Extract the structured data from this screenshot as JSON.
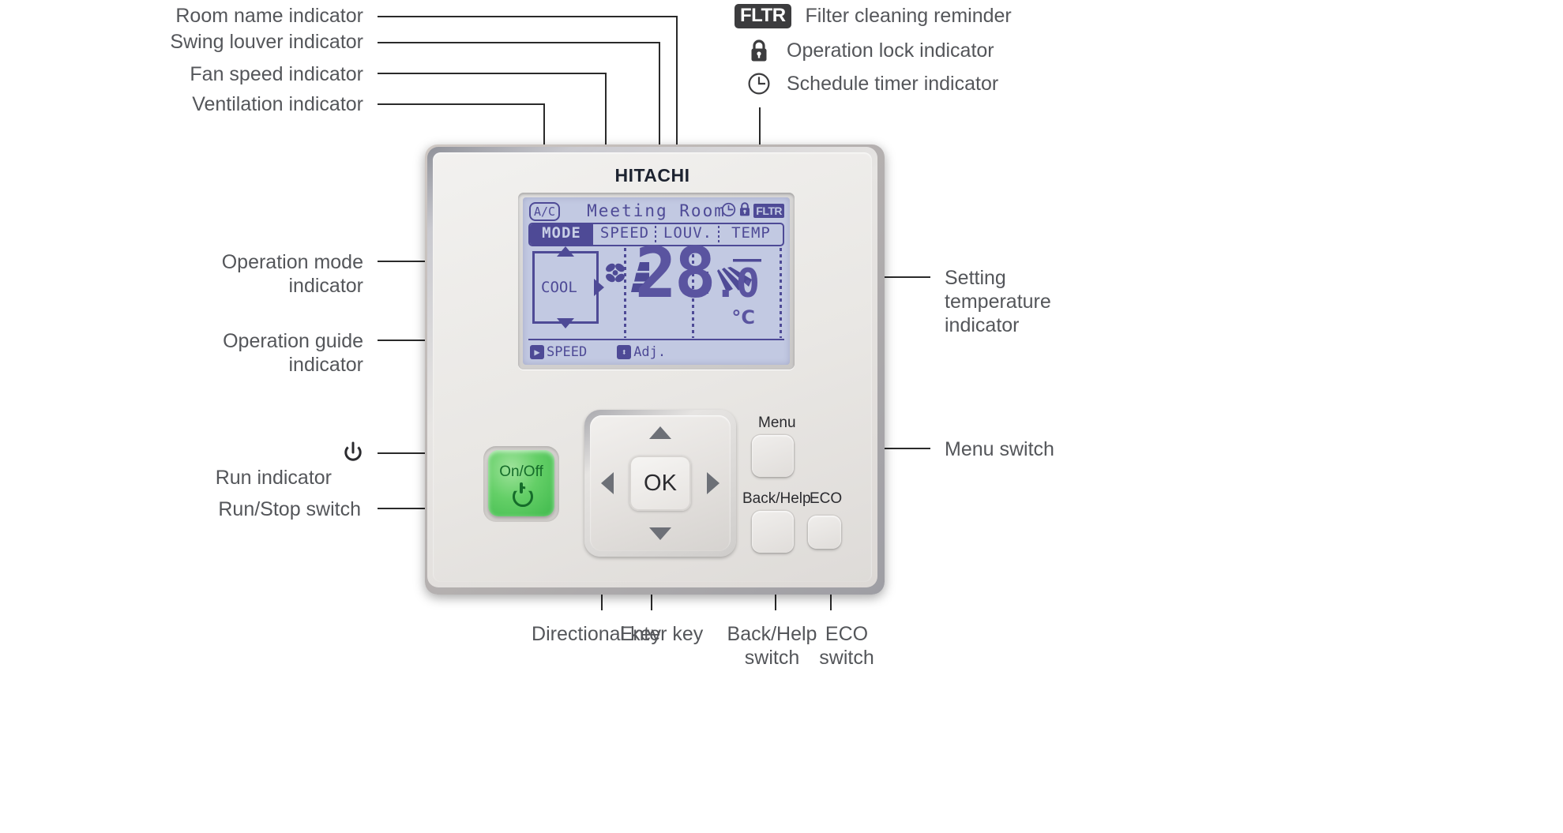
{
  "device": {
    "brand": "HITACHI",
    "type": "wall-mounted air conditioner remote controller"
  },
  "lcd": {
    "ventilation_badge": "A/C",
    "room_name": "Meeting Room",
    "status_icons": {
      "schedule_timer": "clock-icon",
      "operation_lock": "lock-icon",
      "filter_reminder": "FLTR"
    },
    "tabs": [
      {
        "label": "MODE",
        "active": true
      },
      {
        "label": "SPEED",
        "active": false
      },
      {
        "label": "LOUV.",
        "active": false
      },
      {
        "label": "TEMP",
        "active": false
      }
    ],
    "operation_mode": "COOL",
    "fan_speed_icon": "fan-speed-icon",
    "louver_icon": "swing-louver-icon",
    "temperature": {
      "integer": "28",
      "decimal": ".0",
      "unit": "°C"
    },
    "guide": [
      {
        "key": "▶",
        "label": "SPEED"
      },
      {
        "key": "⬍",
        "label": "Adj."
      }
    ]
  },
  "buttons": {
    "onoff_label": "On/Off",
    "ok_label": "OK",
    "menu_label": "Menu",
    "back_help_label": "Back/Help",
    "eco_label": "ECO"
  },
  "legend": [
    {
      "icon": "FLTR",
      "text": "Filter cleaning reminder"
    },
    {
      "icon": "lock-icon",
      "text": "Operation lock indicator"
    },
    {
      "icon": "clock-icon",
      "text": "Schedule timer indicator"
    }
  ],
  "annotations": {
    "room_name": "Room name indicator",
    "swing_louver": "Swing louver indicator",
    "fan_speed": "Fan speed indicator",
    "ventilation": "Ventilation indicator",
    "operation_mode": "Operation mode\nindicator",
    "operation_guide": "Operation guide\nindicator",
    "run_indicator": "Run indicator",
    "run_stop_switch": "Run/Stop switch",
    "setting_temperature": "Setting\ntemperature\nindicator",
    "menu_switch": "Menu switch",
    "directional_key": "Directional key",
    "enter_key": "Enter key",
    "back_help_switch": "Back/Help\nswitch",
    "eco_switch": "ECO\nswitch"
  },
  "colors": {
    "lcd_background": "#c2c9e2",
    "lcd_ink": "#4e4a96",
    "onoff_green": "#4fc45a",
    "annotation_text": "#54565a",
    "leader_line": "#2a2a2a"
  }
}
